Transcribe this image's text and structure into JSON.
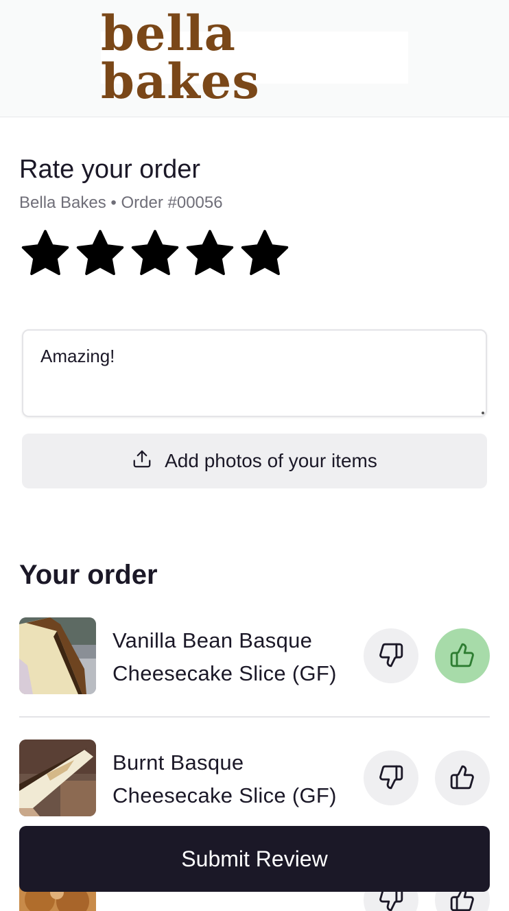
{
  "header": {
    "logo_text": "bella bakes"
  },
  "rating": {
    "title": "Rate your order",
    "subtitle": "Bella Bakes • Order #00056",
    "stars_selected": 5,
    "stars_total": 5,
    "review_text": "Amazing!",
    "add_photos_label": "Add photos of your items"
  },
  "order": {
    "section_title": "Your order",
    "items": [
      {
        "name": "Vanilla Bean Basque Cheesecake Slice (GF)",
        "vote": "up"
      },
      {
        "name": "Burnt Basque Cheesecake Slice (GF)",
        "vote": "none"
      },
      {
        "name": "",
        "vote": "none"
      }
    ]
  },
  "submit_label": "Submit Review",
  "colors": {
    "brand": "#7a4718",
    "primary": "#1b1827",
    "thumbs_up_active_bg": "#a7dba9",
    "thumbs_up_active_icon": "#2e7d32",
    "button_bg": "#efeff1"
  },
  "icons": {
    "star": "star-icon",
    "upload": "upload-icon",
    "thumbs_down": "thumbs-down-icon",
    "thumbs_up": "thumbs-up-icon"
  }
}
